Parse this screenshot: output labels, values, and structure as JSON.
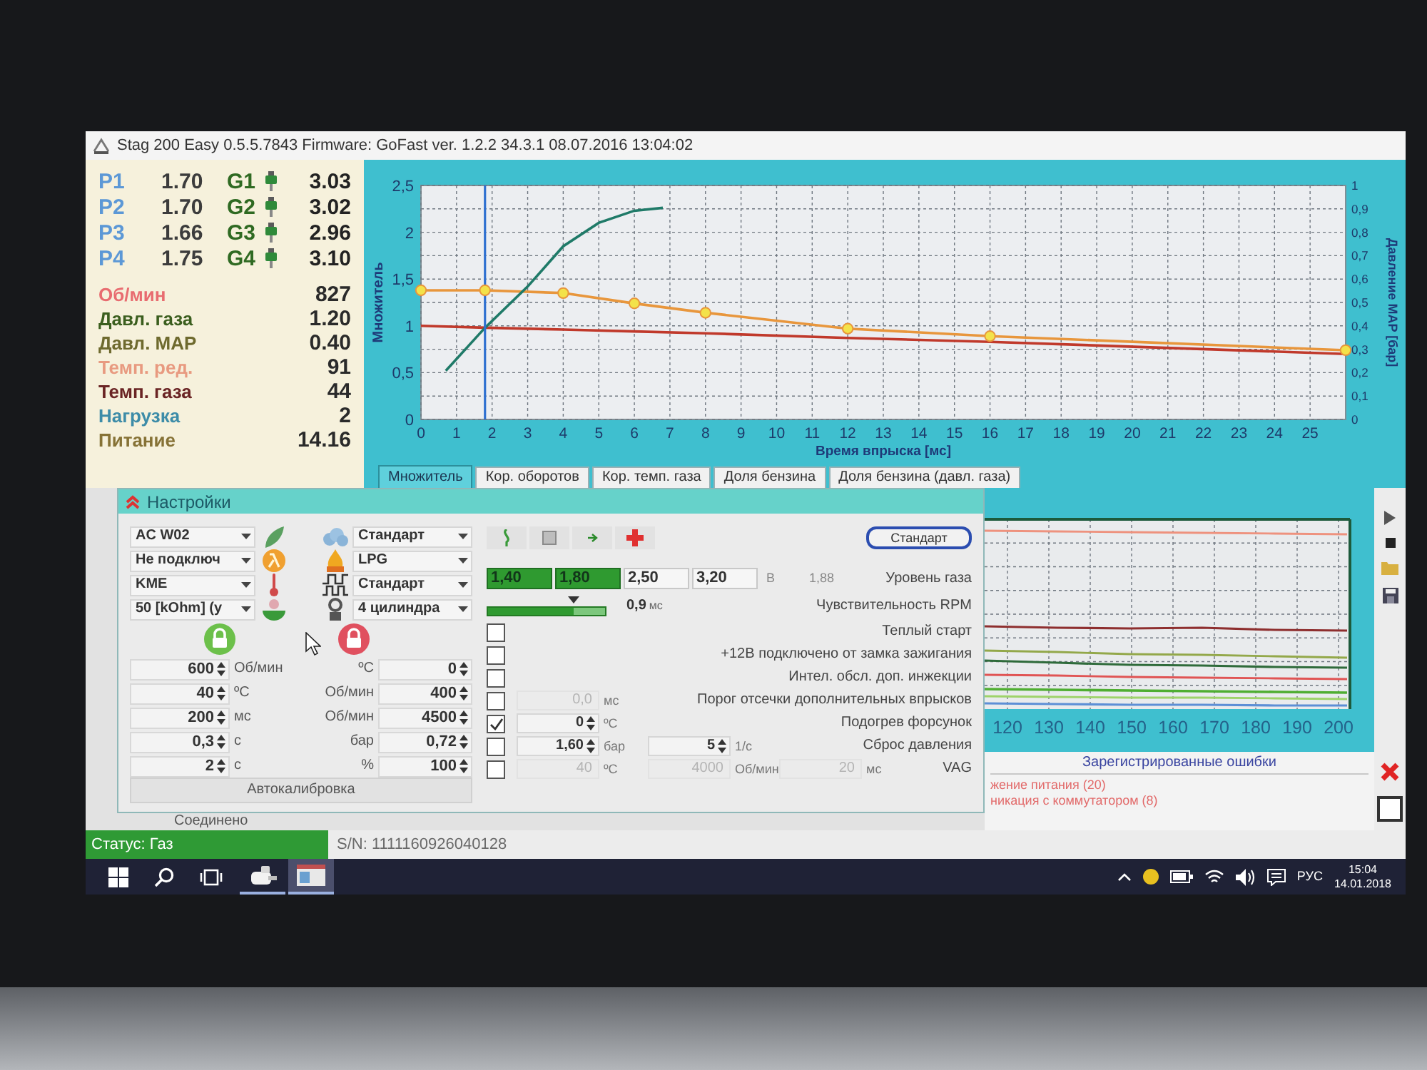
{
  "window": {
    "title": "Stag 200 Easy 0.5.5.7843 Firmware: GoFast ver. 1.2.2 34.3.1 08.07.2016 13:04:02"
  },
  "injectors": [
    {
      "p_label": "P1",
      "p_value": "1.70",
      "g_label": "G1",
      "g_value": "3.03"
    },
    {
      "p_label": "P2",
      "p_value": "1.70",
      "g_label": "G2",
      "g_value": "3.02"
    },
    {
      "p_label": "P3",
      "p_value": "1.66",
      "g_label": "G3",
      "g_value": "2.96"
    },
    {
      "p_label": "P4",
      "p_value": "1.75",
      "g_label": "G4",
      "g_value": "3.10"
    }
  ],
  "readings": [
    {
      "label": "Об/мин",
      "value": "827",
      "color": "#e86c70"
    },
    {
      "label": "Давл. газа",
      "value": "1.20",
      "color": "#3b5e1e"
    },
    {
      "label": "Давл. MAP",
      "value": "0.40",
      "color": "#6e6a2e"
    },
    {
      "label": "Темп. ред.",
      "value": "91",
      "color": "#e89a80"
    },
    {
      "label": "Темп. газа",
      "value": "44",
      "color": "#6a2424"
    },
    {
      "label": "Нагрузка",
      "value": "2",
      "color": "#3d8ca8"
    },
    {
      "label": "Питание",
      "value": "14.16",
      "color": "#867236"
    }
  ],
  "main_chart": {
    "chart_data": {
      "type": "line",
      "grid": true,
      "xlabel": "Время впрыска [мс]",
      "ylabel": "Множитель",
      "x": [
        0,
        1.8,
        4,
        6,
        8,
        12,
        16,
        26
      ],
      "series": [
        {
          "color": "#e8963c",
          "marker": "circle",
          "values": [
            1.38,
            1.38,
            1.35,
            1.24,
            1.14,
            0.97,
            0.89,
            0.74
          ]
        },
        {
          "color": "#c0392b",
          "values": [
            1.0,
            0.98,
            0.96,
            0.94,
            0.92,
            0.87,
            0.83,
            0.7
          ]
        },
        {
          "color": "#1f7a68",
          "x": [
            0.7,
            1.8,
            3,
            4,
            5,
            6,
            6.8
          ],
          "values": [
            0.52,
            0.98,
            1.42,
            1.85,
            2.1,
            2.23,
            2.26
          ]
        }
      ],
      "xlim": [
        0,
        26
      ],
      "ylim": [
        0,
        2.5
      ],
      "xticks": [
        0,
        1,
        2,
        3,
        4,
        5,
        6,
        7,
        8,
        9,
        10,
        11,
        12,
        13,
        14,
        15,
        16,
        17,
        18,
        19,
        20,
        21,
        22,
        23,
        24,
        25
      ],
      "yticks": [
        {
          "value": 0,
          "label": "0"
        },
        {
          "value": 0.5,
          "label": "0,5"
        },
        {
          "value": 1,
          "label": "1"
        },
        {
          "value": 1.5,
          "label": "1,5"
        },
        {
          "value": 2,
          "label": "2"
        },
        {
          "value": 2.5,
          "label": "2,5"
        }
      ],
      "y2label": "Давление MAP [бар]",
      "y2lim": [
        0,
        1
      ],
      "y2ticks": [
        {
          "value": 0,
          "label": "0"
        },
        {
          "value": 0.1,
          "label": "0,1"
        },
        {
          "value": 0.2,
          "label": "0,2"
        },
        {
          "value": 0.3,
          "label": "0,3"
        },
        {
          "value": 0.4,
          "label": "0,4"
        },
        {
          "value": 0.5,
          "label": "0,5"
        },
        {
          "value": 0.6,
          "label": "0,6"
        },
        {
          "value": 0.7,
          "label": "0,7"
        },
        {
          "value": 0.8,
          "label": "0,8"
        },
        {
          "value": 0.9,
          "label": "0,9"
        },
        {
          "value": 1,
          "label": "1"
        }
      ],
      "ref_lines": [
        {
          "axis": "x",
          "value": 1.8,
          "color": "#2f70d0"
        }
      ]
    },
    "tabs": [
      {
        "label": "Множитель",
        "selected": true
      },
      {
        "label": "Кор. оборотов",
        "selected": false
      },
      {
        "label": "Кор. темп. газа",
        "selected": false
      },
      {
        "label": "Доля бензина",
        "selected": false
      },
      {
        "label": "Доля бензина (давл. газа)",
        "selected": false
      }
    ]
  },
  "settings": {
    "title": "Настройки",
    "left_selects": [
      "AC W02",
      "Не подключ",
      "KME",
      "50 [kOhm] (y"
    ],
    "right_selects": [
      "Стандарт",
      "LPG",
      "Стандарт",
      "4 цилиндра"
    ],
    "spin_rows": [
      {
        "left": {
          "value": "600",
          "unit": "Об/мин"
        },
        "right": {
          "unit": "ºC",
          "value": "0"
        }
      },
      {
        "left": {
          "value": "40",
          "unit": "ºC"
        },
        "right": {
          "unit": "Об/мин",
          "value": "400"
        }
      },
      {
        "left": {
          "value": "200",
          "unit": "мс"
        },
        "right": {
          "unit": "Об/мин",
          "value": "4500"
        }
      },
      {
        "left": {
          "value": "0,3",
          "unit": "с"
        },
        "right": {
          "unit": "бар",
          "value": "0,72"
        }
      },
      {
        "left": {
          "value": "2",
          "unit": "с"
        },
        "right": {
          "unit": "%",
          "value": "100"
        }
      }
    ],
    "autocalibration": "Автокалибровка",
    "preset_button": "Стандарт",
    "gas_levels": [
      {
        "value": "1,40",
        "on": true
      },
      {
        "value": "1,80",
        "on": true
      },
      {
        "value": "2,50",
        "on": false
      },
      {
        "value": "3,20",
        "on": false
      }
    ],
    "gas_unit": "В",
    "gas_reading": "1,88",
    "gas_label": "Уровень газа",
    "rpm": {
      "level": 0.73,
      "value": "0,9",
      "unit": "мс",
      "label": "Чувствительность RPM"
    },
    "options": [
      {
        "label": "Теплый старт",
        "checked": false
      },
      {
        "label": "+12В подключено от замка зажигания",
        "checked": false
      },
      {
        "label": "Интел. обсл. доп. инжекции",
        "checked": false
      },
      {
        "label": "Порог отсечки дополнительных впрысков",
        "checked": false,
        "fields": [
          {
            "value": "0,0",
            "unit": "мс",
            "disabled": true
          }
        ]
      },
      {
        "label": "Подогрев форсунок",
        "checked": true,
        "fields": [
          {
            "value": "0",
            "unit": "ºC",
            "disabled": false
          }
        ]
      },
      {
        "label": "Сброс давления",
        "checked": false,
        "fields": [
          {
            "value": "1,60",
            "unit": "бар",
            "disabled": false
          },
          {
            "value": "5",
            "unit": "1/с",
            "disabled": false
          }
        ]
      },
      {
        "label": "VAG",
        "checked": false,
        "fields": [
          {
            "value": "40",
            "unit": "ºC",
            "disabled": true
          },
          {
            "value": "4000",
            "unit": "Об/мин",
            "disabled": true
          },
          {
            "value": "20",
            "unit": "мс",
            "disabled": true
          }
        ]
      }
    ]
  },
  "lower_chart": {
    "x_tick_labels": [
      "120",
      "130",
      "140",
      "150",
      "160",
      "170",
      "180",
      "190",
      "200"
    ]
  },
  "errors": {
    "title": "Зарегистрированные ошибки",
    "items": [
      "жение питания (20)",
      "никация с коммутатором (8)"
    ],
    "checkbox_checked": false
  },
  "connection": "Соединено",
  "status_bar": {
    "status": "Статус: Газ",
    "serial": "S/N: 1111160926040128"
  },
  "taskbar": {
    "apps": [
      {
        "kind": "stag",
        "selected": false
      },
      {
        "kind": "window",
        "selected": true
      }
    ],
    "language": "РУС",
    "time": "15:04",
    "date": "14.01.2018"
  }
}
